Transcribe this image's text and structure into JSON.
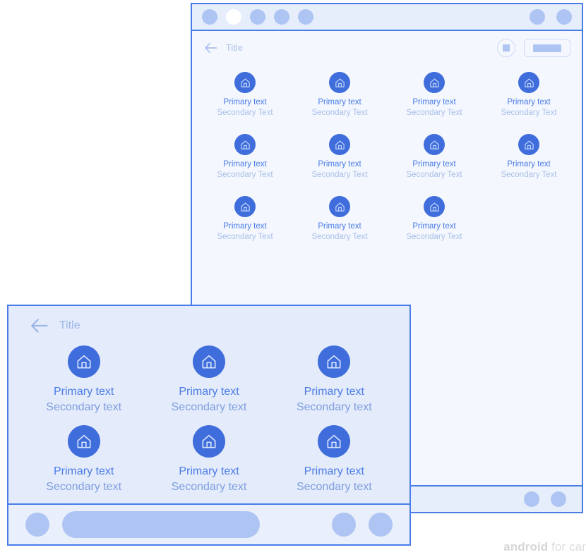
{
  "back_window": {
    "status_bar": {
      "left_dots": [
        "dot",
        "dot-active",
        "dot",
        "dot",
        "dot"
      ],
      "right_dots": [
        "dot",
        "dot"
      ]
    },
    "app_bar": {
      "back_icon": "arrow-left-icon",
      "title": "Title",
      "actions": [
        {
          "name": "stop-circle-button",
          "shape": "circle-square"
        },
        {
          "name": "pill-button",
          "shape": "rounded-rect-bar"
        }
      ]
    },
    "grid": {
      "columns": 4,
      "items": [
        {
          "icon": "home-icon",
          "primary": "Primary text",
          "secondary": "Secondary Text"
        },
        {
          "icon": "home-icon",
          "primary": "Primary text",
          "secondary": "Secondary Text"
        },
        {
          "icon": "home-icon",
          "primary": "Primary text",
          "secondary": "Secondary Text"
        },
        {
          "icon": "home-icon",
          "primary": "Primary text",
          "secondary": "Secondary Text"
        },
        {
          "icon": "home-icon",
          "primary": "Primary text",
          "secondary": "Secondary Text"
        },
        {
          "icon": "home-icon",
          "primary": "Primary text",
          "secondary": "Secondary Text"
        },
        {
          "icon": "home-icon",
          "primary": "Primary text",
          "secondary": "Secondary Text"
        },
        {
          "icon": "home-icon",
          "primary": "Primary text",
          "secondary": "Secondary Text"
        },
        {
          "icon": "home-icon",
          "primary": "Primary text",
          "secondary": "Secondary Text"
        },
        {
          "icon": "home-icon",
          "primary": "Primary text",
          "secondary": "Secondary Text"
        },
        {
          "icon": "home-icon",
          "primary": "Primary text",
          "secondary": "Secondary Text"
        }
      ]
    },
    "bottom_bar": {
      "right_dots": [
        "dot",
        "dot"
      ]
    }
  },
  "front_window": {
    "app_bar": {
      "back_icon": "arrow-left-icon",
      "title": "Title"
    },
    "grid": {
      "columns": 3,
      "items": [
        {
          "icon": "home-icon",
          "primary": "Primary text",
          "secondary": "Secondary text"
        },
        {
          "icon": "home-icon",
          "primary": "Primary text",
          "secondary": "Secondary text"
        },
        {
          "icon": "home-icon",
          "primary": "Primary text",
          "secondary": "Secondary text"
        },
        {
          "icon": "home-icon",
          "primary": "Primary text",
          "secondary": "Secondary text"
        },
        {
          "icon": "home-icon",
          "primary": "Primary text",
          "secondary": "Secondary text"
        },
        {
          "icon": "home-icon",
          "primary": "Primary text",
          "secondary": "Secondary text"
        }
      ]
    },
    "bottom_bar": {
      "left_dot": "dot",
      "search_pill": "search-pill",
      "right_dots": [
        "dot",
        "dot"
      ]
    }
  },
  "watermark": {
    "strong": "android",
    "rest": " for car"
  },
  "colors": {
    "accent_blue": "#4a7ce8",
    "icon_fill": "#3f6ddb",
    "light_blue": "#aec5f3",
    "back_bg": "#f4f7fd",
    "front_bg": "#e4ebfa",
    "bar_bg": "#e6edfb",
    "secondary_text": "#a9c0ea",
    "watermark_gray": "#dcdcdc"
  }
}
